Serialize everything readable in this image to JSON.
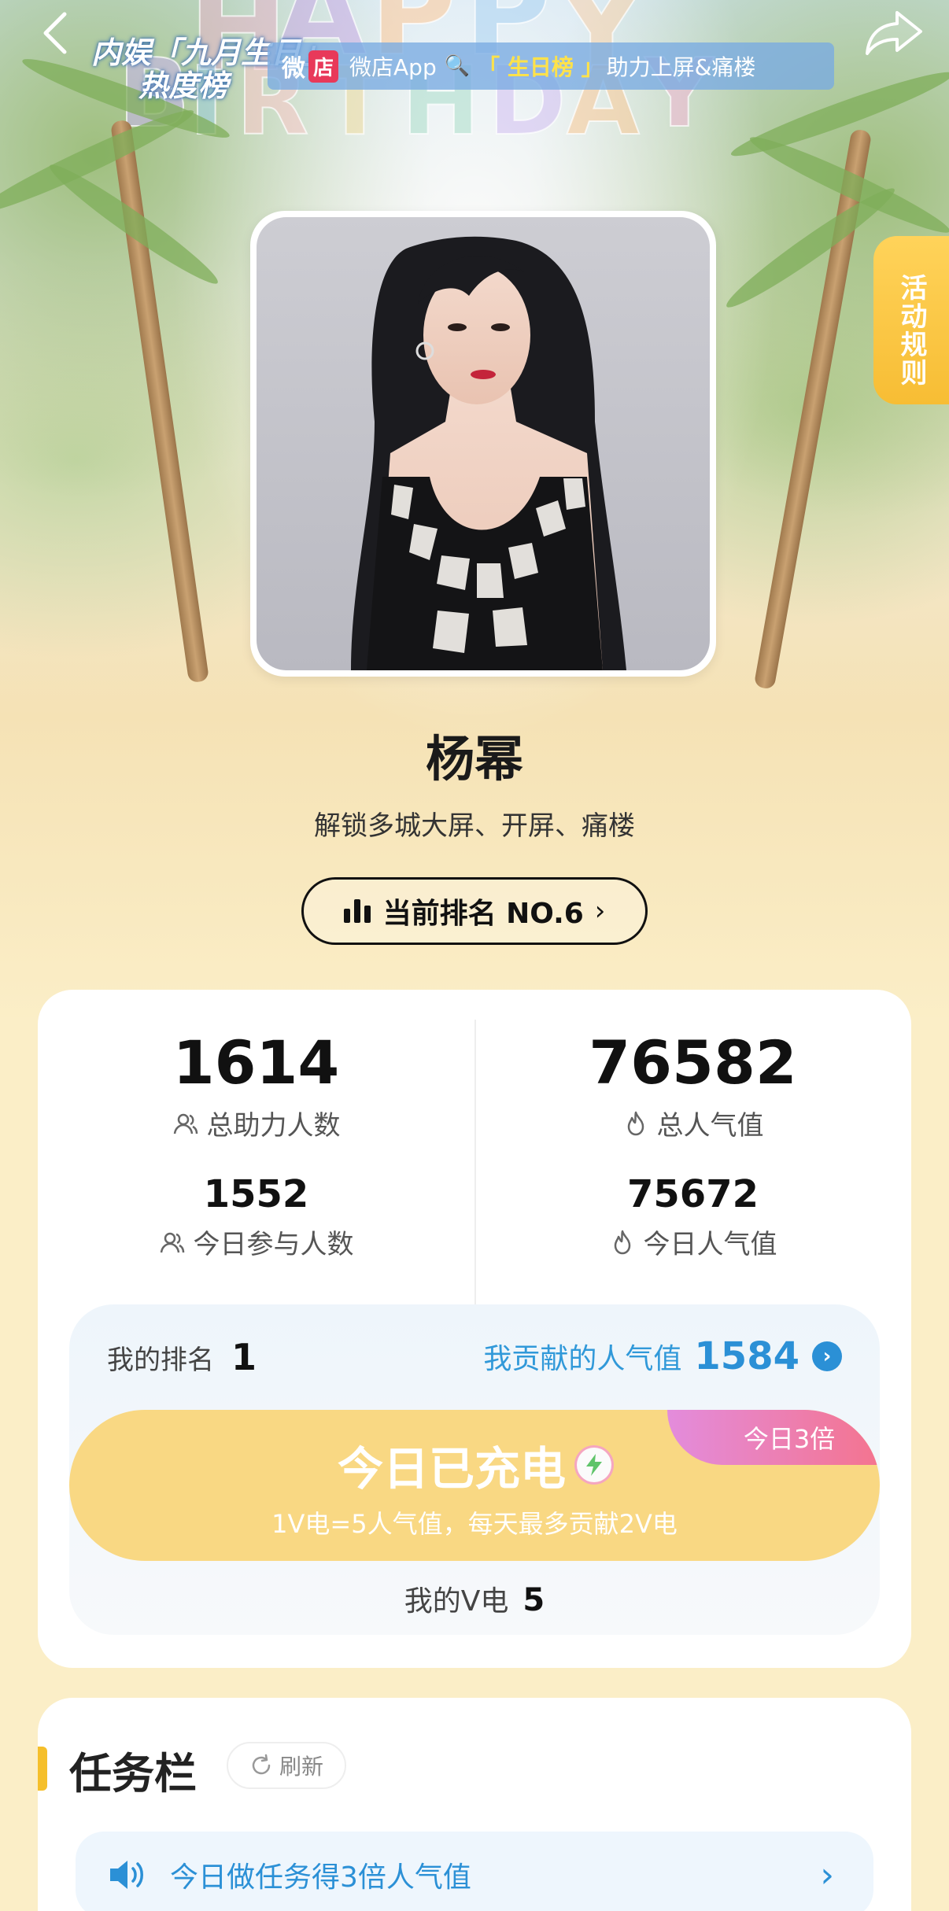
{
  "header": {
    "logo_line1": "内娱「九月生日」",
    "logo_line2": "热度榜",
    "banner": {
      "wei": "微",
      "dian": "店",
      "app_text": "微店App",
      "highlight": "「 生日榜 」",
      "suffix": "助力上屏&痛楼"
    }
  },
  "background_text": "HAPPY BIRTHDAY",
  "rules_tab": "活动规则",
  "star": {
    "name": "杨幂",
    "subtitle": "解锁多城大屏、开屏、痛楼",
    "rank_label": "当前排名 NO.6"
  },
  "stats": {
    "total_supporters": {
      "value": "1614",
      "label": "总助力人数"
    },
    "total_popularity": {
      "value": "76582",
      "label": "总人气值"
    },
    "today_participants": {
      "value": "1552",
      "label": "今日参与人数"
    },
    "today_popularity": {
      "value": "75672",
      "label": "今日人气值"
    }
  },
  "my": {
    "rank_label": "我的排名",
    "rank_value": "1",
    "contrib_label": "我贡献的人气值",
    "contrib_value": "1584",
    "charge_title": "今日已充电",
    "charge_desc": "1V电=5人气值，每天最多贡献2V电",
    "triple_badge": "今日3倍",
    "v_label": "我的V电",
    "v_value": "5"
  },
  "tasks": {
    "title": "任务栏",
    "refresh": "刷新",
    "row_text": "今日做任务得3倍人气值"
  },
  "colors": {
    "accent_blue": "#2b90d6",
    "charge_yellow": "#f9d883",
    "rules_yellow": "#f7bd34",
    "badge_pink": "#f4748f",
    "page_bg": "#fbeec7"
  }
}
